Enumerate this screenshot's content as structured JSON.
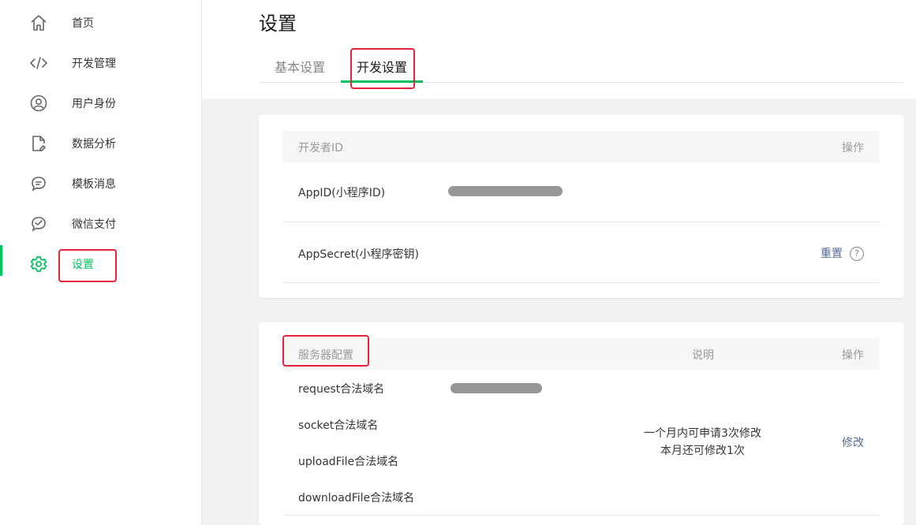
{
  "sidebar": {
    "items": [
      {
        "label": "首页",
        "icon": "home-icon"
      },
      {
        "label": "开发管理",
        "icon": "code-icon"
      },
      {
        "label": "用户身份",
        "icon": "user-icon"
      },
      {
        "label": "数据分析",
        "icon": "document-icon"
      },
      {
        "label": "模板消息",
        "icon": "message-icon"
      },
      {
        "label": "微信支付",
        "icon": "payment-icon"
      },
      {
        "label": "设置",
        "icon": "gear-icon",
        "active": true
      }
    ]
  },
  "page": {
    "title": "设置",
    "tabs": [
      {
        "label": "基本设置"
      },
      {
        "label": "开发设置",
        "active": true
      }
    ]
  },
  "developer": {
    "header": {
      "col1": "开发者ID",
      "col2": "操作"
    },
    "rows": [
      {
        "name": "AppID(小程序ID)"
      },
      {
        "name": "AppSecret(小程序密钥)",
        "action": "重置",
        "help": "?"
      }
    ]
  },
  "server": {
    "header": {
      "col1": "服务器配置",
      "col2": "说明",
      "col3": "操作"
    },
    "domains": [
      "request合法域名",
      "socket合法域名",
      "uploadFile合法域名",
      "downloadFile合法域名"
    ],
    "note_line1": "一个月内可申请3次修改",
    "note_line2": "本月还可修改1次",
    "action": "修改"
  },
  "colors": {
    "accent": "#07c160",
    "highlight": "#e8233b",
    "link": "#576b95"
  }
}
